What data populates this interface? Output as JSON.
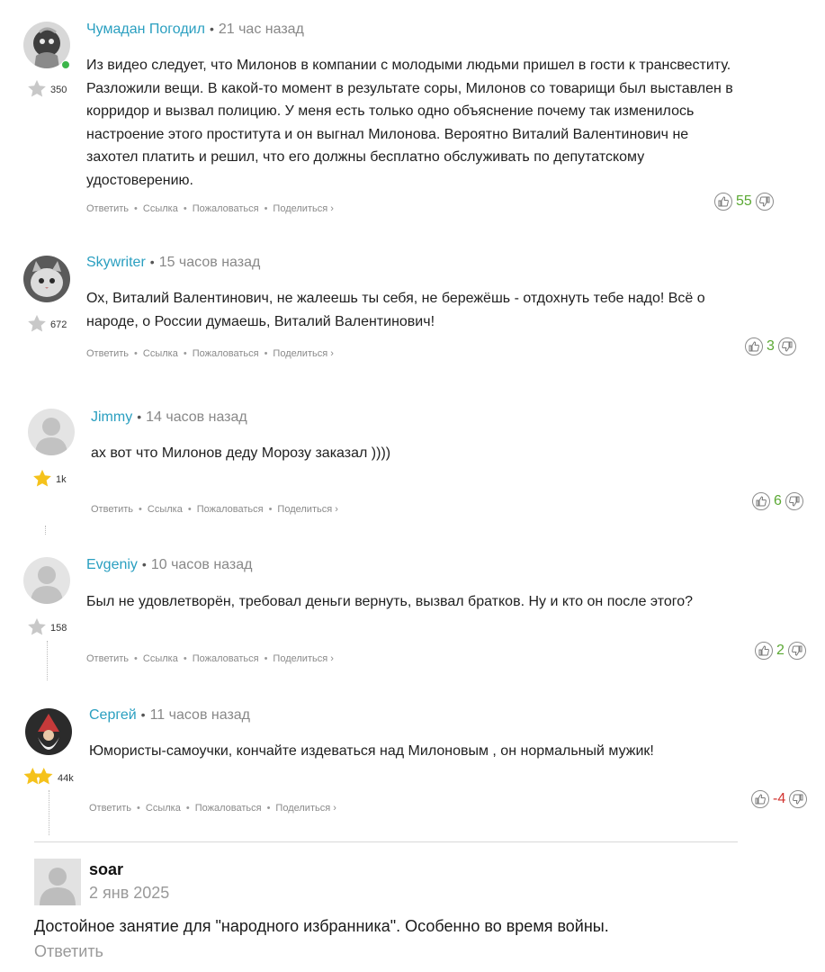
{
  "comments": [
    {
      "author": "Чумадан Погодил",
      "time": "21 час назад",
      "rating": "350",
      "lines": [
        "Из видео следует, что Милонов в компании с молодыми людьми пришел в гости к трансвеститу.",
        "Разложили вещи. В какой-то момент в результате соры, Милонов со товарищи был выставлен в",
        "корридор и вызвал полицию. У меня есть только одно объяснение почему так изменилось",
        "настроение этого проститута и он выгнал Милонова. Вероятно Виталий Валентинович не",
        "захотел платить и решил, что его должны бесплатно обслуживать по депутатскому",
        "удостоверению."
      ],
      "votes": "55"
    },
    {
      "author": "Skywriter",
      "time": "15 часов назад",
      "rating": "672",
      "lines": [
        "Ох, Виталий Валентинович, не жалеешь ты себя, не бережёшь - отдохнуть тебе надо! Всё о",
        "народе, о России думаешь, Виталий Валентинович!"
      ],
      "votes": "3"
    },
    {
      "author": "Jimmy",
      "time": "14 часов назад",
      "rating": "1k",
      "lines": [
        "ах вот что Милонов деду Морозу заказал ))))"
      ],
      "votes": "6"
    },
    {
      "author": "Evgeniy",
      "time": "10 часов назад",
      "rating": "158",
      "lines": [
        "Был не удовлетворён, требовал деньги вернуть, вызвал братков. Ну и кто он после этого?"
      ],
      "votes": "2"
    },
    {
      "author": "Сергей",
      "time": "11 часов назад",
      "rating": "44k",
      "lines": [
        "Юмористы-самоучки, кончайте издеваться над Милоновым , он нормальный мужик!"
      ],
      "votes": "-4"
    }
  ],
  "actions": {
    "reply": "Ответить",
    "link": "Ссылка",
    "report": "Пожаловаться",
    "share": "Поделиться ›"
  },
  "reply_comment": {
    "author": "soar",
    "date": "2 янв 2025",
    "text": "Достойное занятие для \"народного избранника\". Особенно во время войны.",
    "reply": "Ответить"
  },
  "colors": {
    "author_link": "#2a9fc0",
    "vote_positive": "#5aa832",
    "vote_negative": "#d2332f",
    "star_gold": "#f5c21b",
    "star_gray": "#c8c8c8"
  },
  "icons": {
    "like": "thumbs-up-icon",
    "dislike": "thumbs-down-icon",
    "rating": "star-icon"
  }
}
